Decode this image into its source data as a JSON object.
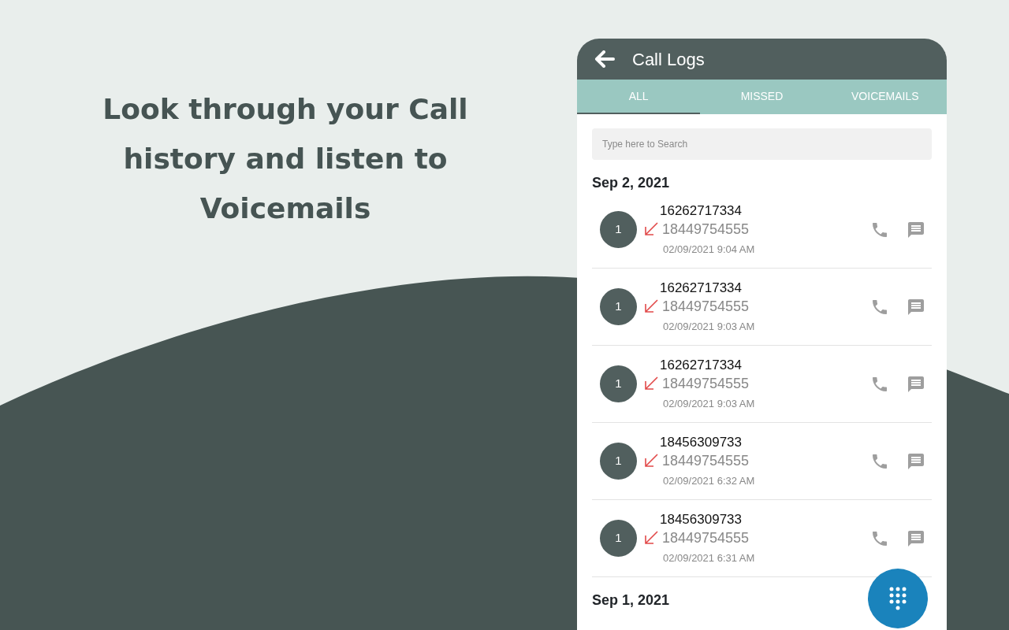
{
  "headline": "Look through your Call history and listen to Voicemails",
  "app": {
    "title": "Call Logs",
    "tabs": [
      {
        "label": "ALL",
        "selected": true
      },
      {
        "label": "MISSED",
        "selected": false
      },
      {
        "label": "VOICEMAILS",
        "selected": false
      }
    ],
    "search": {
      "placeholder": "Type here to Search"
    },
    "groups": [
      {
        "date": "Sep 2, 2021",
        "calls": [
          {
            "badge": "1",
            "caller": "16262717334",
            "number": "18449754555",
            "time": "02/09/2021 9:04 AM"
          },
          {
            "badge": "1",
            "caller": "16262717334",
            "number": "18449754555",
            "time": "02/09/2021 9:03 AM"
          },
          {
            "badge": "1",
            "caller": "16262717334",
            "number": "18449754555",
            "time": "02/09/2021 9:03 AM"
          },
          {
            "badge": "1",
            "caller": "18456309733",
            "number": "18449754555",
            "time": "02/09/2021 6:32 AM"
          },
          {
            "badge": "1",
            "caller": "18456309733",
            "number": "18449754555",
            "time": "02/09/2021 6:31 AM"
          }
        ]
      },
      {
        "date": "Sep 1, 2021"
      }
    ]
  }
}
